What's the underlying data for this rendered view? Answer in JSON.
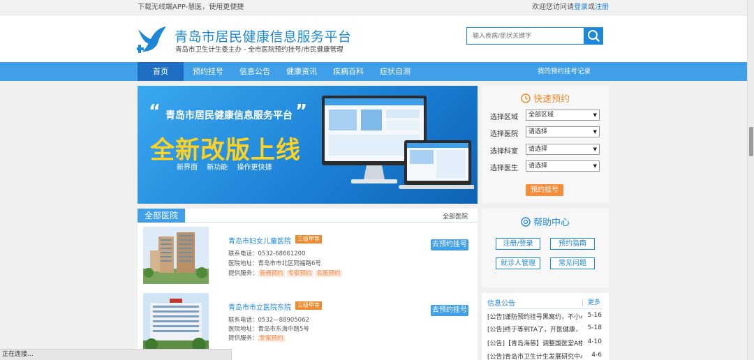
{
  "topbar": {
    "download_text": "下载无线端APP-慧医，使用更便捷",
    "welcome_text": "欢迎您访问请",
    "login_link": "登录",
    "or_text": "或",
    "register_link": "注册"
  },
  "header": {
    "title": "青岛市居民健康信息服务平台",
    "subtitle": "青岛市卫生计生委主办 - 全市医院预约挂号/市民健康管理",
    "search_placeholder": "输入疾病/症状关键字"
  },
  "nav": {
    "items": [
      {
        "label": "首页",
        "active": true
      },
      {
        "label": "预约挂号"
      },
      {
        "label": "信息公告"
      },
      {
        "label": "健康资讯"
      },
      {
        "label": "疾病百科"
      },
      {
        "label": "症状自测"
      }
    ],
    "my_records": "我的预约挂号记录"
  },
  "banner": {
    "title": "青岛市居民健康信息服务平台",
    "headline": "全新改版上线",
    "features": "新界面 新功能 操作更快捷"
  },
  "quick_booking": {
    "title": "快速预约",
    "fields": [
      {
        "label": "选择区域",
        "value": "全部区域"
      },
      {
        "label": "选择医院",
        "value": "请选择"
      },
      {
        "label": "选择科室",
        "value": "请选择"
      },
      {
        "label": "选择医生",
        "value": "请选择"
      }
    ],
    "submit_label": "预约挂号"
  },
  "help_center": {
    "title": "帮助中心",
    "buttons": [
      "注册/登录",
      "预约指南",
      "就诊人管理",
      "常见问题"
    ]
  },
  "notices": {
    "title": "信息公告",
    "more": "更多",
    "items": [
      {
        "text": "[公告]谨防预约挂号黑窝约，不小心...",
        "date": "5-16"
      },
      {
        "text": "[公告]终于等到TA了，开医健康，可...",
        "date": "5-18"
      },
      {
        "text": "[公告]【青岛海慈】调整国医堂A楼...",
        "date": "4-10"
      },
      {
        "text": "[公告]青岛市卫生计生发展研究中心L...",
        "date": "4-6"
      }
    ]
  },
  "hospitals": {
    "tab_label": "全部医院",
    "all_link": "全部医院",
    "book_label": "去预约挂号",
    "phone_label": "联系电话：",
    "address_label": "医院地址：",
    "service_label": "提供服务：",
    "list": [
      {
        "name": "青岛市妇女儿童医院",
        "level": "三级甲等",
        "phone": "0532-68661200",
        "address": "青岛市市北区同福路6号",
        "services": [
          "普通预约",
          "专家预约",
          "名医预约"
        ]
      },
      {
        "name": "青岛市市立医院东院",
        "level": "三级甲等",
        "phone": "0532—88905062",
        "address": "青岛市东海中路5号",
        "services": [
          "专家预约"
        ]
      }
    ]
  },
  "status_bar": "正在连接...",
  "colors": {
    "primary_blue": "#3f9fe9",
    "dark_blue": "#1e6fc3",
    "accent_orange": "#f78c3a",
    "headline_yellow": "#ffd21f"
  }
}
